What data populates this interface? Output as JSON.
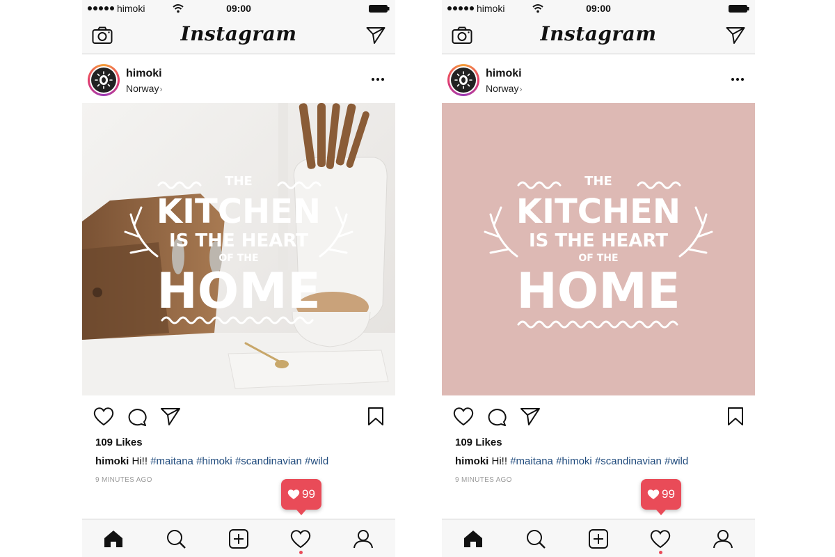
{
  "phones": [
    {
      "status_bar": {
        "carrier": "himoki",
        "time": "09:00"
      },
      "nav": {
        "logo": "Instagram"
      },
      "post": {
        "username": "himoki",
        "location": "Norway",
        "image_text": {
          "line1": "THE",
          "line2": "KITCHEN",
          "line3": "IS THE HEART",
          "line4": "OF THE",
          "line5": "HOME"
        },
        "likes": "109 Likes",
        "caption_user": "himoki",
        "caption_text": "Hi!!",
        "hashtags": [
          "#maitana",
          "#himoki",
          "#scandinavian",
          "#wild"
        ],
        "timestamp": "9 MINUTES AGO"
      },
      "notification": {
        "count": "99"
      }
    },
    {
      "status_bar": {
        "carrier": "himoki",
        "time": "09:00"
      },
      "nav": {
        "logo": "Instagram"
      },
      "post": {
        "username": "himoki",
        "location": "Norway",
        "image_text": {
          "line1": "THE",
          "line2": "KITCHEN",
          "line3": "IS THE HEART",
          "line4": "OF THE",
          "line5": "HOME"
        },
        "likes": "109 Likes",
        "caption_user": "himoki",
        "caption_text": "Hi!!",
        "hashtags": [
          "#maitana",
          "#himoki",
          "#scandinavian",
          "#wild"
        ],
        "timestamp": "9 MINUTES AGO"
      },
      "notification": {
        "count": "99"
      }
    }
  ],
  "icons": {
    "status": [
      "signal-dots-icon",
      "wifi-icon",
      "battery-icon"
    ],
    "nav": [
      "camera-icon",
      "direct-message-icon"
    ],
    "actions": [
      "heart-icon",
      "comment-icon",
      "share-icon",
      "bookmark-icon"
    ],
    "tabs": [
      "home-icon",
      "search-icon",
      "add-post-icon",
      "activity-heart-icon",
      "profile-icon"
    ]
  },
  "colors": {
    "notification_red": "#e94b58",
    "hashtag_blue": "#1f4a7c",
    "pink_background": "#ddb9b4",
    "bar_background": "#f7f7f7"
  }
}
